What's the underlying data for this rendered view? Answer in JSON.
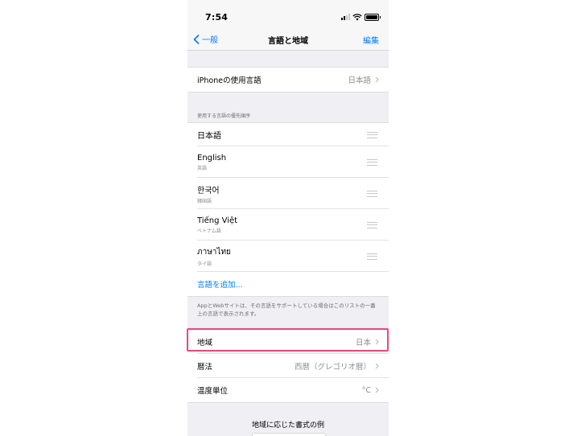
{
  "status_bar": {
    "time": "7:54"
  },
  "nav": {
    "back_label": "一般",
    "title": "言語と地域",
    "edit_label": "編集"
  },
  "iphone_language": {
    "label": "iPhoneの使用言語",
    "value": "日本語"
  },
  "preferred": {
    "header": "使用する言語の優先順序",
    "languages": [
      {
        "name": "日本語",
        "sub": ""
      },
      {
        "name": "English",
        "sub": "英語"
      },
      {
        "name": "한국어",
        "sub": "韓国語"
      },
      {
        "name": "Tiếng Việt",
        "sub": "ベトナム語"
      },
      {
        "name": "ภาษาไทย",
        "sub": "タイ語"
      }
    ],
    "add_label": "言語を追加..."
  },
  "footer_note": "AppとWebサイトは、その言語をサポートしている場合はこのリストの一番上の言語で表示されます。",
  "region_settings": [
    {
      "label": "地域",
      "value": "日本"
    },
    {
      "label": "暦法",
      "value": "西暦（グレゴリオ暦）"
    },
    {
      "label": "温度単位",
      "value": "°C"
    }
  ],
  "format_example_title": "地域に応じた書式の例",
  "colors": {
    "accent": "#007aff",
    "highlight": "#f0447e",
    "background": "#efeff4"
  }
}
